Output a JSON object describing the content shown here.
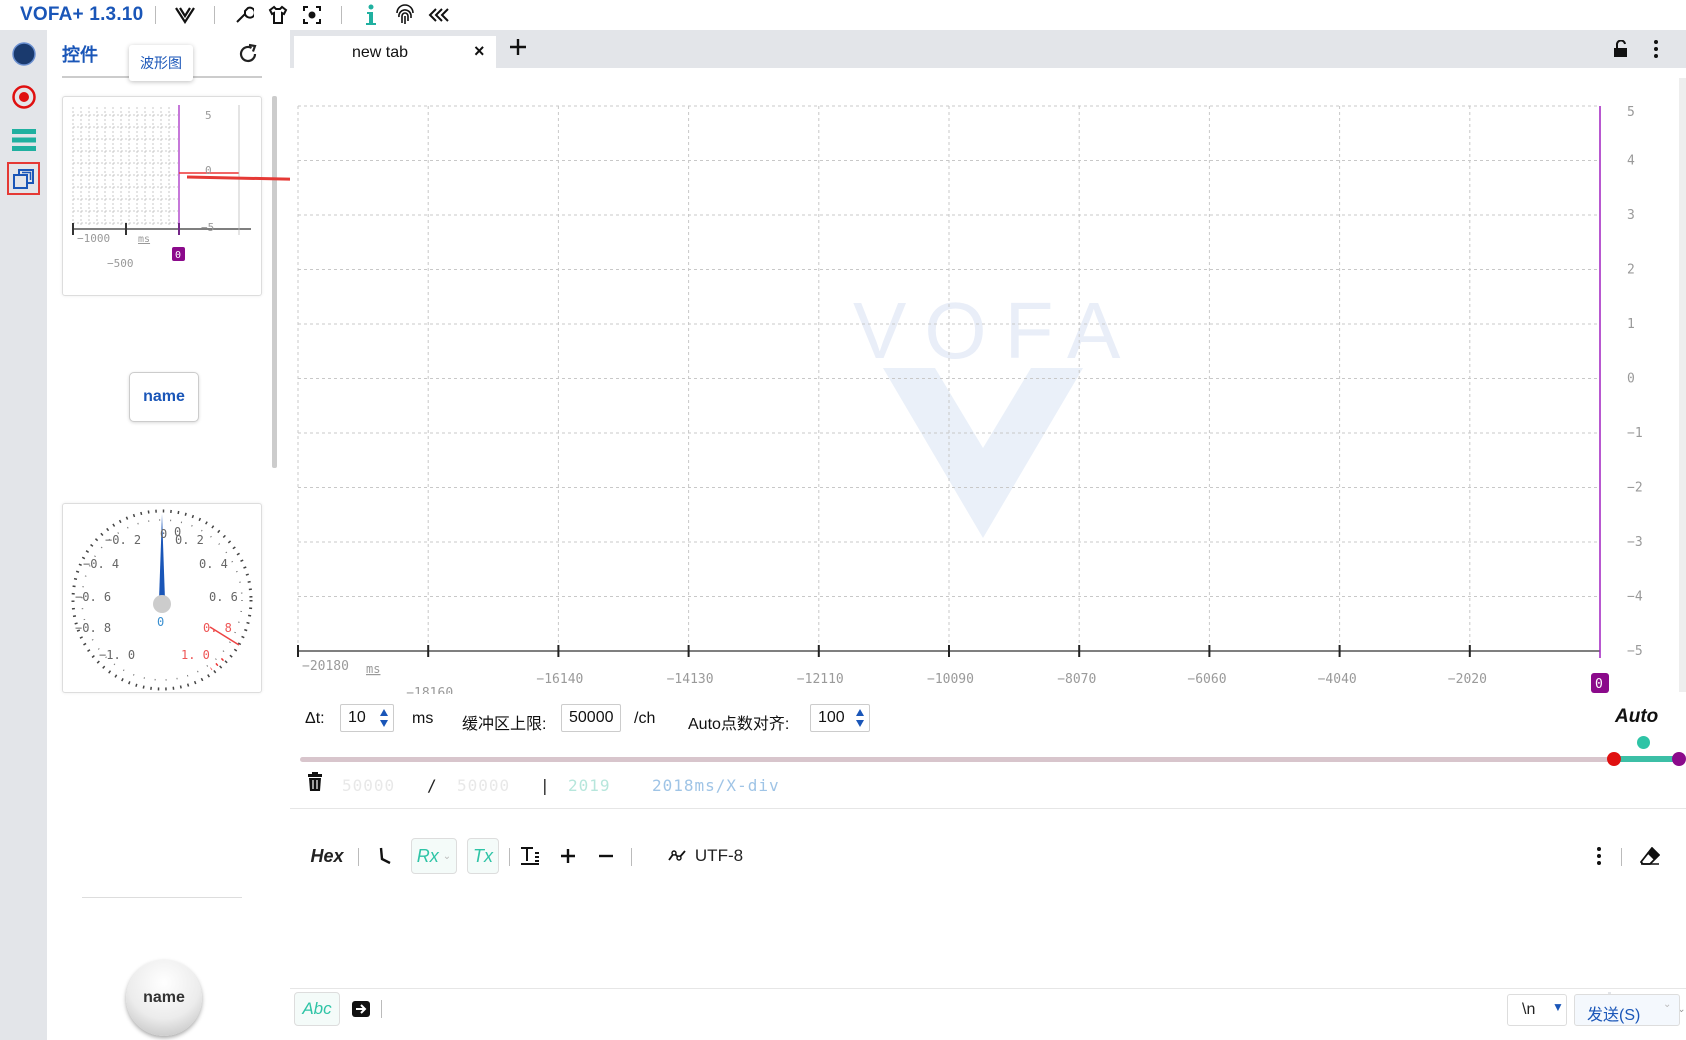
{
  "titlebar": {
    "app_title": "VOFA+ 1.3.10",
    "icons": [
      "vofa-logo-icon",
      "wrench-icon",
      "shirt-icon",
      "screenshot-icon",
      "info-icon",
      "fingerprint-icon",
      "collapse-icon"
    ]
  },
  "leftbar": {
    "items": [
      "connection-status-icon",
      "record-icon",
      "command-list-icon",
      "widgets-icon"
    ],
    "active_item": "widgets-icon"
  },
  "widget_panel": {
    "title": "控件",
    "tooltip": "波形图",
    "preview_scope": {
      "y_ticks": [
        "5",
        "0",
        "−5"
      ],
      "x_ticks": [
        "−1000",
        "−500"
      ],
      "unit": "ms",
      "channel": "0"
    },
    "button_widget_label": "name",
    "gauge": {
      "left_labels": [
        "−0. 2",
        "−0. 4",
        "−0. 6",
        "−0. 8",
        "−1. 0"
      ],
      "right_labels": [
        "0. 2",
        "0. 4",
        "0. 6",
        "0. 8",
        "1. 0"
      ],
      "top_labels": [
        "0",
        "0"
      ],
      "value": "0"
    },
    "knob_label": "name"
  },
  "tabs": {
    "items": [
      {
        "label": "new tab"
      }
    ],
    "close_glyph": "×",
    "add_glyph": "+"
  },
  "scope": {
    "watermark": "VOFA",
    "y_ticks": [
      "5",
      "4",
      "3",
      "2",
      "1",
      "0",
      "−1",
      "−2",
      "−3",
      "−4",
      "−5"
    ],
    "x_ticks": [
      "−20180",
      "−18160",
      "−16140",
      "−14130",
      "−12110",
      "−10090",
      "−8070",
      "−6060",
      "−4040",
      "−2020"
    ],
    "x_unit": "ms",
    "channel_badge": "0",
    "colors": {
      "grid": "#c8c8c8",
      "cursor": "#a020c0",
      "channel": "#8b0a8b",
      "watermark": "#e8eef8"
    }
  },
  "controls": {
    "dt_label": "Δt:",
    "dt_value": "10",
    "dt_unit": "ms",
    "buffer_label": "缓冲区上限:",
    "buffer_value": "50000",
    "buffer_unit": "/ch",
    "auto_align_label": "Auto点数对齐:",
    "auto_align_value": "100",
    "auto_label": "Auto",
    "stats": {
      "count_a": "50000",
      "slash": "/",
      "count_b": "50000",
      "bar": "|",
      "window": "2019",
      "div": "2018ms/X-div"
    },
    "range_slider": {
      "start": 0.963,
      "end": 1.0,
      "marker_colors": [
        "#e01010",
        "#2ec4a6",
        "#8b0a8b"
      ]
    }
  },
  "data_toolbar": {
    "hex_label": "Hex",
    "rx_label": "Rx",
    "tx_label": "Tx",
    "encoding_label": "UTF-8"
  },
  "send_bar": {
    "abc_label": "Abc",
    "newline_value": "\\n",
    "send_label": "发送(S)"
  }
}
